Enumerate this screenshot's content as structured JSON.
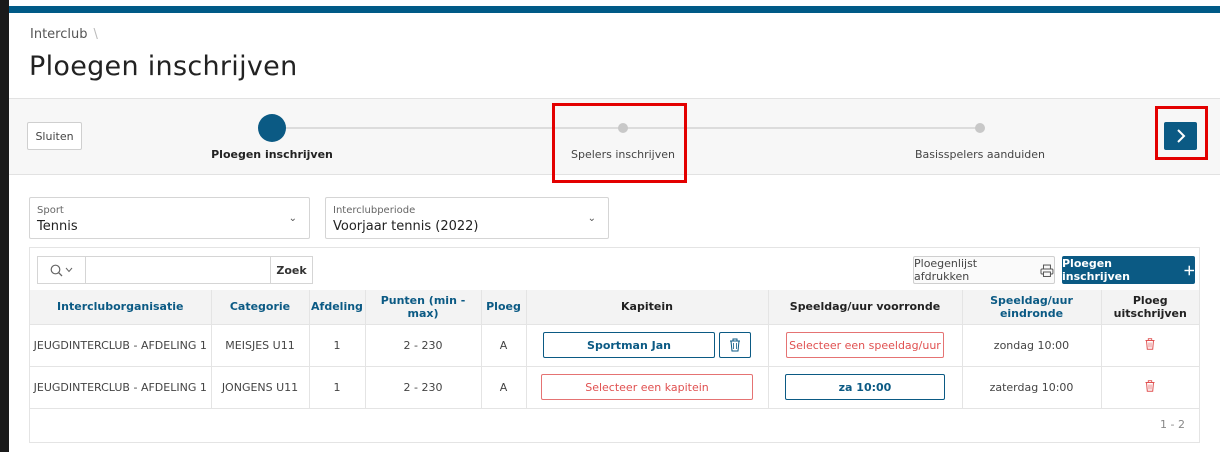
{
  "breadcrumb": {
    "root": "Interclub",
    "separator": "\\"
  },
  "page_title": "Ploegen inschrijven",
  "wizard": {
    "close_label": "Sluiten",
    "steps": [
      {
        "label": "Ploegen inschrijven",
        "state": "active"
      },
      {
        "label": "Spelers inschrijven",
        "state": "inactive"
      },
      {
        "label": "Basisspelers aanduiden",
        "state": "inactive"
      }
    ],
    "next_icon": "chevron-right-icon"
  },
  "filters": {
    "sport": {
      "label": "Sport",
      "value": "Tennis"
    },
    "period": {
      "label": "Interclubperiode",
      "value": "Voorjaar tennis (2022)"
    }
  },
  "toolbar": {
    "search_placeholder": "",
    "search_button": "Zoek",
    "print_label": "Ploegenlijst afdrukken",
    "add_label": "Ploegen inschrijven"
  },
  "table": {
    "columns": [
      "Intercluborganisatie",
      "Categorie",
      "Afdeling",
      "Punten (min - max)",
      "Ploeg",
      "Kapitein",
      "Speeldag/uur voorronde",
      "Speeldag/uur eindronde",
      "Ploeg uitschrijven"
    ],
    "rows": [
      {
        "organisatie": "JEUGDINTERCLUB - AFDELING 1",
        "categorie": "MEISJES U11",
        "afdeling": "1",
        "punten": "2 - 230",
        "ploeg": "A",
        "kapitein": "Sportman Jan",
        "voorronde": "Selecteer een speeldag/uur",
        "eindronde": "zondag 10:00"
      },
      {
        "organisatie": "JEUGDINTERCLUB - AFDELING 1",
        "categorie": "JONGENS U11",
        "afdeling": "1",
        "punten": "2 - 230",
        "ploeg": "A",
        "kapitein": "Selecteer een kapitein",
        "voorronde": "za 10:00",
        "eindronde": "zaterdag 10:00"
      }
    ]
  },
  "pager": "1 - 2",
  "colors": {
    "primary": "#0b5a84",
    "highlight": "#e30000",
    "danger": "#e05050"
  }
}
